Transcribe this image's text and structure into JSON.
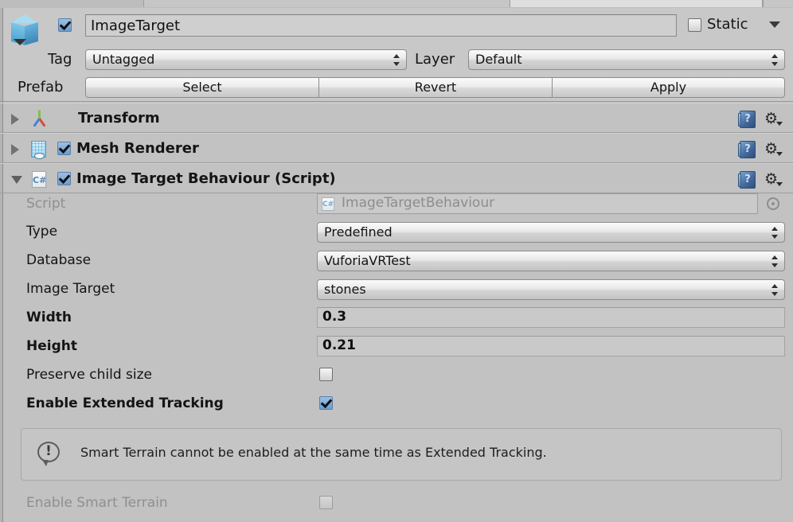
{
  "window": {
    "tabs": [
      {
        "label": "",
        "active": false
      },
      {
        "label": "",
        "active": true
      },
      {
        "label": "",
        "active": false
      }
    ]
  },
  "gameobject": {
    "icon": "prefab-cube-icon",
    "enabled": true,
    "name": "ImageTarget",
    "static_label": "Static",
    "static_checked": false,
    "tag_label": "Tag",
    "tag_value": "Untagged",
    "layer_label": "Layer",
    "layer_value": "Default",
    "prefab_label": "Prefab",
    "prefab_buttons": [
      "Select",
      "Revert",
      "Apply"
    ]
  },
  "components": [
    {
      "title": "Transform",
      "icon": "transform-axis-icon",
      "expanded": false,
      "has_enable_checkbox": false,
      "enabled": false
    },
    {
      "title": "Mesh Renderer",
      "icon": "mesh-renderer-icon",
      "expanded": false,
      "has_enable_checkbox": true,
      "enabled": true
    },
    {
      "title": "Image Target Behaviour (Script)",
      "icon": "csharp-script-icon",
      "expanded": true,
      "has_enable_checkbox": true,
      "enabled": true
    }
  ],
  "script_component": {
    "fields": [
      {
        "label": "Script",
        "type": "object",
        "value": "ImageTargetBehaviour",
        "disabled": true,
        "bold": false
      },
      {
        "label": "Type",
        "type": "popup",
        "value": "Predefined",
        "disabled": false,
        "bold": false
      },
      {
        "label": "Database",
        "type": "popup",
        "value": "VuforiaVRTest",
        "disabled": false,
        "bold": false
      },
      {
        "label": "Image Target",
        "type": "popup",
        "value": "stones",
        "disabled": false,
        "bold": false
      },
      {
        "label": "Width",
        "type": "number",
        "value": "0.3",
        "disabled": false,
        "bold": true
      },
      {
        "label": "Height",
        "type": "number",
        "value": "0.21",
        "disabled": false,
        "bold": true
      },
      {
        "label": "Preserve child size",
        "type": "toggle",
        "value": false,
        "disabled": false,
        "bold": false
      },
      {
        "label": "Enable Extended Tracking",
        "type": "toggle",
        "value": true,
        "disabled": false,
        "bold": true
      }
    ],
    "helpbox": {
      "icon": "warning-bubble-icon",
      "glyph": "!",
      "text": "Smart Terrain cannot be enabled at the same time as Extended Tracking."
    },
    "smart_terrain": {
      "label": "Enable Smart Terrain",
      "value": false,
      "disabled": true
    }
  },
  "icons": {
    "help_glyph": "?",
    "gear_glyph": "⚙"
  },
  "colors": {
    "background": "#c2c2c2",
    "header_background": "#c8c8c8",
    "checkbox_checked": "#84abd8",
    "field_background": "#c9c9c9",
    "muted_text": "#8f8f8f"
  }
}
